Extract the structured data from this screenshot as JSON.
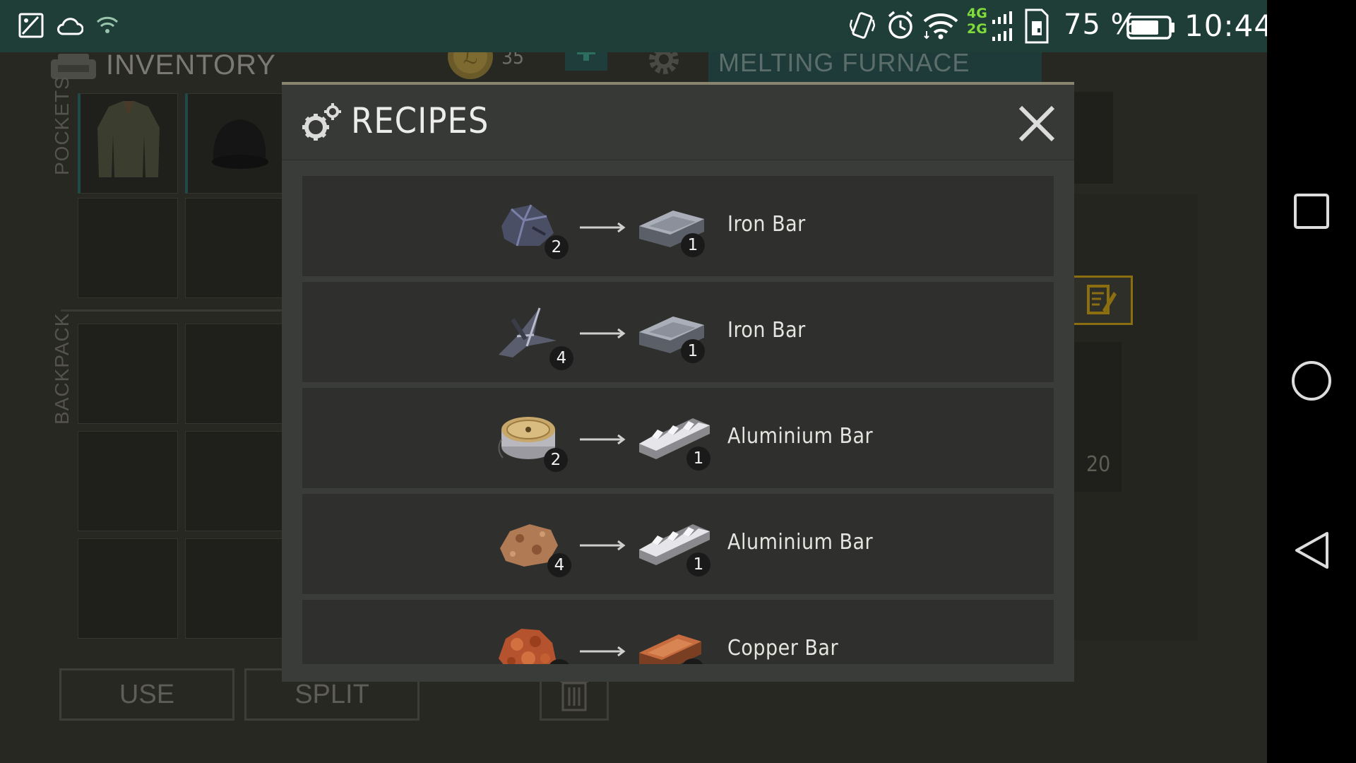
{
  "status_bar": {
    "battery_percent": "75 %",
    "time": "10:44",
    "network_4g": "4G",
    "network_2g": "2G"
  },
  "background": {
    "inventory_title": "INVENTORY",
    "coins": "35",
    "furnace_title": "MELTING FURNACE",
    "pockets_label": "POCKETS",
    "backpack_label": "BACKPACK",
    "use_button": "USE",
    "split_button": "SPLIT",
    "stack_count": "20"
  },
  "modal": {
    "title": "RECIPES",
    "recipes": [
      {
        "input_item": "ore-chunk",
        "input_count": "2",
        "output_item": "iron-bar",
        "output_count": "1",
        "name": "Iron Bar"
      },
      {
        "input_item": "scrap-metal",
        "input_count": "4",
        "output_item": "iron-bar",
        "output_count": "1",
        "name": "Iron Bar"
      },
      {
        "input_item": "wire-spool",
        "input_count": "2",
        "output_item": "aluminium-bar",
        "output_count": "1",
        "name": "Aluminium Bar"
      },
      {
        "input_item": "bauxite-ore",
        "input_count": "4",
        "output_item": "aluminium-bar",
        "output_count": "1",
        "name": "Aluminium Bar"
      },
      {
        "input_item": "copper-ore",
        "input_count": "",
        "output_item": "copper-bar",
        "output_count": "",
        "name": "Copper Bar"
      }
    ]
  },
  "colors": {
    "status_bar_bg": "#1f3e38",
    "modal_bg": "#3a3c39",
    "row_bg": "#2f302e",
    "accent_gold": "#c9a227",
    "teal_accent": "#1f4a48"
  }
}
